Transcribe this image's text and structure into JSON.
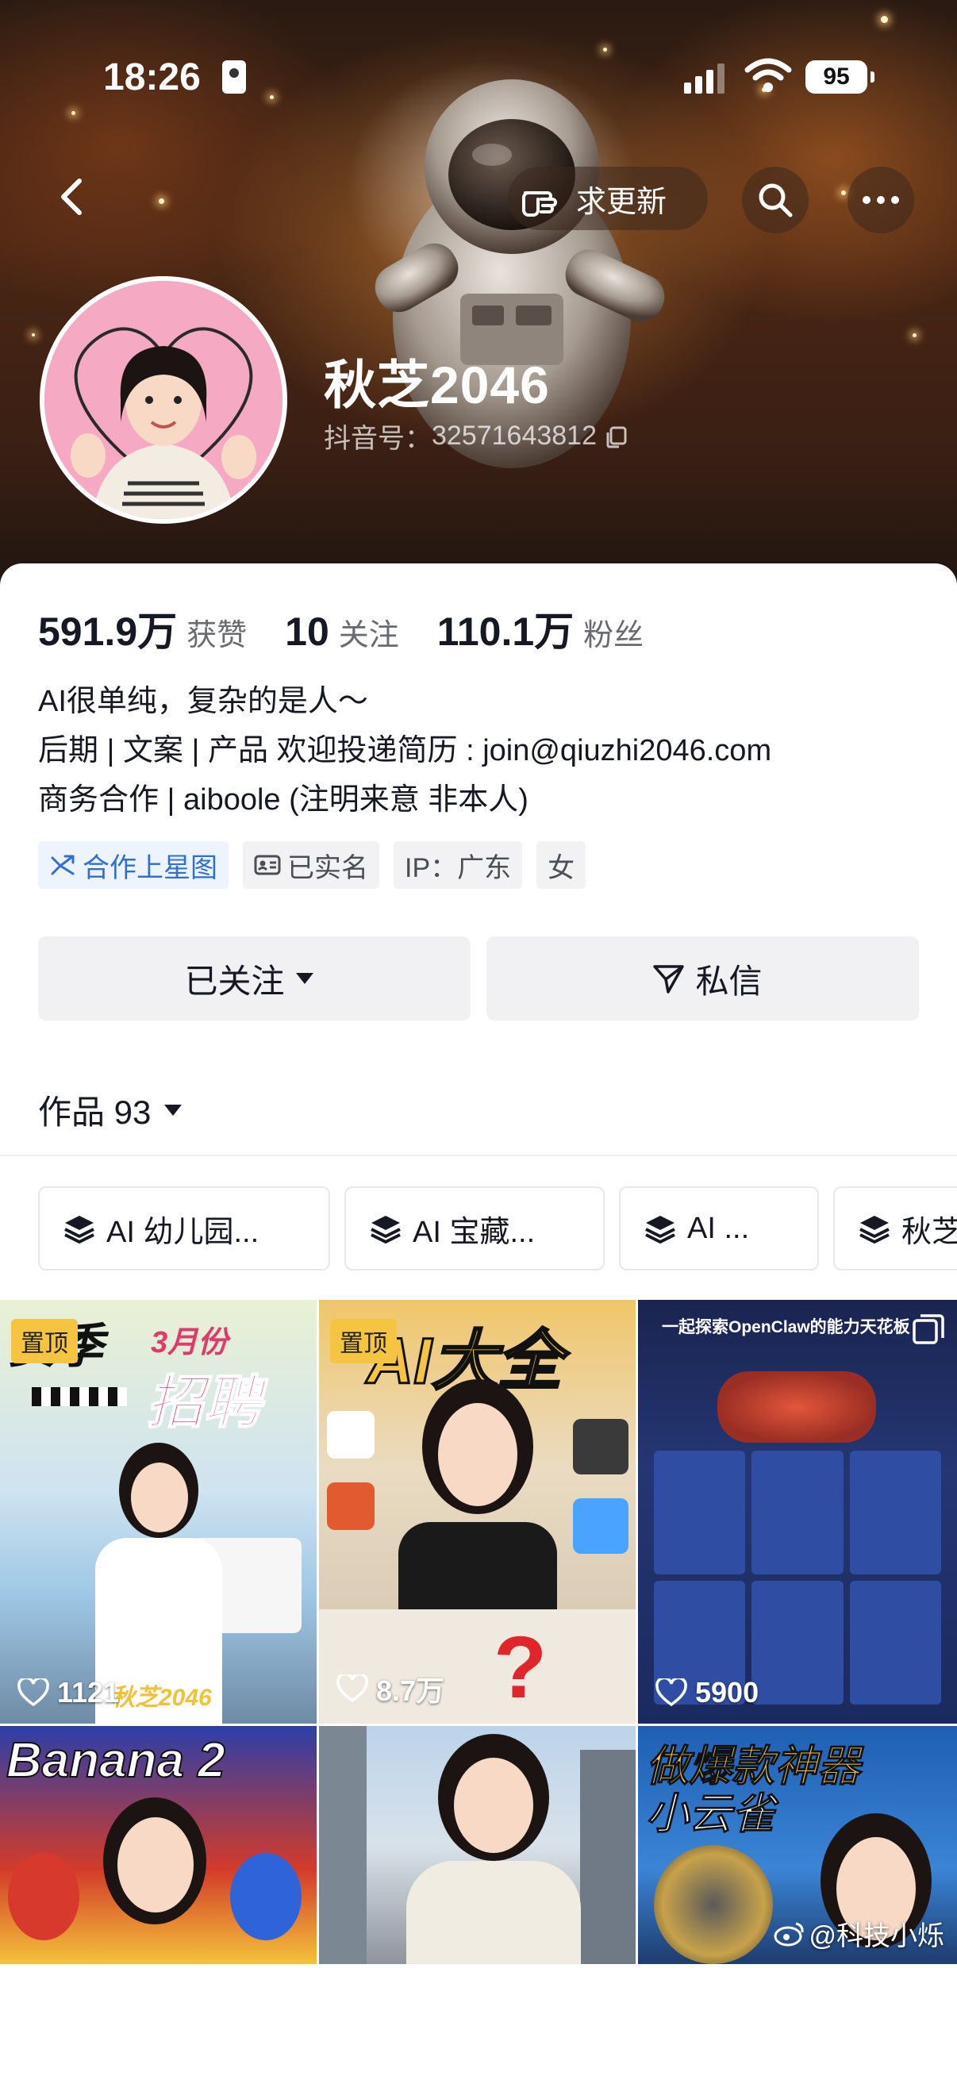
{
  "status_bar": {
    "time": "18:26",
    "battery": "95"
  },
  "nav": {
    "request_update_label": "求更新"
  },
  "profile": {
    "name": "秋芝2046",
    "douyin_id_label": "抖音号：",
    "douyin_id": "32571643812"
  },
  "stats": [
    {
      "value": "591.9万",
      "label": "获赞"
    },
    {
      "value": "10",
      "label": "关注"
    },
    {
      "value": "110.1万",
      "label": "粉丝"
    }
  ],
  "bio": {
    "line1": "AI很单纯，复杂的是人～",
    "line2": "后期 | 文案 | 产品 欢迎投递简历 : join@qiuzhi2046.com",
    "line3": "商务合作 | aiboole (注明来意 非本人)"
  },
  "tags": {
    "star_map": "合作上星图",
    "verified": "已实名",
    "ip": "IP：广东",
    "gender": "女"
  },
  "actions": {
    "following": "已关注",
    "message": "私信"
  },
  "works": {
    "label": "作品 93"
  },
  "collections": [
    "AI 幼儿园...",
    "AI 宝藏...",
    "AI ...",
    "秋芝"
  ],
  "videos": [
    {
      "pinned": "置顶",
      "title_a": "赛季",
      "title_b": "3月份",
      "title_c": "招聘",
      "caption": "秋芝2046",
      "likes": "1121"
    },
    {
      "pinned": "置顶",
      "title_a": "AI大全",
      "likes": "8.7万"
    },
    {
      "title_a": "一起探索OpenClaw的能力天花板",
      "likes": "5900"
    },
    {
      "title_a": "Banana 2"
    },
    {},
    {
      "title_a": "做爆款神器",
      "title_b": "小云雀"
    }
  ],
  "watermark": "@科技小烁",
  "colors": {
    "accent_blue": "#2f6fd6",
    "pin_yellow": "#f5c542",
    "text": "#161823",
    "muted": "#6a6b72"
  }
}
